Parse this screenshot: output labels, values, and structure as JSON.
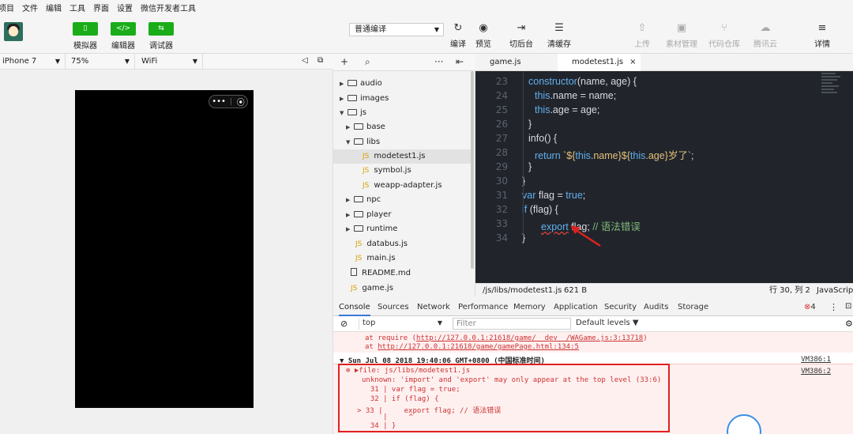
{
  "menu": [
    "项目",
    "文件",
    "编辑",
    "工具",
    "界面",
    "设置",
    "微信开发者工具"
  ],
  "toolbar": {
    "simulator": "模拟器",
    "editor": "编辑器",
    "debugger": "调试器",
    "compile_mode": "普通编译",
    "compile": "编译",
    "preview": "预览",
    "background": "切后台",
    "clear_cache": "清缓存",
    "upload": "上传",
    "assets": "素材管理",
    "repo": "代码仓库",
    "tencent_cloud": "腾讯云",
    "details": "详情",
    "accent_color": "#1aad19"
  },
  "device": {
    "model": "iPhone 7",
    "zoom": "75%",
    "network": "WiFi"
  },
  "tree": [
    {
      "label": "audio",
      "kind": "folder",
      "expanded": false
    },
    {
      "label": "images",
      "kind": "folder",
      "expanded": false
    },
    {
      "label": "js",
      "kind": "folder",
      "expanded": true
    },
    {
      "label": "base",
      "kind": "folder",
      "expanded": false
    },
    {
      "label": "libs",
      "kind": "folder",
      "expanded": true
    },
    {
      "label": "modetest1.js",
      "kind": "js",
      "selected": true
    },
    {
      "label": "symbol.js",
      "kind": "js"
    },
    {
      "label": "weapp-adapter.js",
      "kind": "js"
    },
    {
      "label": "npc",
      "kind": "folder",
      "expanded": false
    },
    {
      "label": "player",
      "kind": "folder",
      "expanded": false
    },
    {
      "label": "runtime",
      "kind": "folder",
      "expanded": false
    },
    {
      "label": "databus.js",
      "kind": "js"
    },
    {
      "label": "main.js",
      "kind": "js"
    },
    {
      "label": "README.md",
      "kind": "doc"
    },
    {
      "label": "game.js",
      "kind": "js"
    }
  ],
  "editor_tabs": [
    {
      "label": "game.js",
      "active": false
    },
    {
      "label": "modetest1.js",
      "active": true,
      "close": "×"
    }
  ],
  "code": {
    "line_numbers": [
      "23",
      "24",
      "25",
      "26",
      "27",
      "28",
      "29",
      "30",
      "31",
      "32",
      "33",
      "34"
    ],
    "line23": {
      "kw": "constructor",
      "rest": "(name, age) {"
    },
    "line24": {
      "kw": "this",
      "rest": ".name = name;"
    },
    "line25": {
      "kw": "this",
      "rest": ".age = age;"
    },
    "line26": "}",
    "line27": "info() {",
    "line28": {
      "kw": "return",
      "s1": " `${",
      "k1": "this",
      "s2": ".name}${",
      "k2": "this",
      "s3": ".age}岁了`",
      "tail": ";"
    },
    "line29": "}",
    "line30": "}",
    "line31": {
      "kw": "var",
      "mid": " flag = ",
      "k2": "true",
      "tail": ";"
    },
    "line32": {
      "kw": "if",
      "rest": " (flag) {"
    },
    "line33": {
      "err": "export",
      "mid": " flag; ",
      "comment": "// 语法错误"
    },
    "line34": "}"
  },
  "status": {
    "path": "/js/libs/modetest1.js",
    "size": "621 B",
    "cursor": "行 30, 列 2",
    "lang": "JavaScript"
  },
  "devtools": {
    "tabs": [
      "Console",
      "Sources",
      "Network",
      "Performance",
      "Memory",
      "Application",
      "Security",
      "Audits",
      "Storage"
    ],
    "error_count": "4",
    "context": "top",
    "filter_placeholder": "Filter",
    "levels": "Default levels ▼"
  },
  "console": {
    "trace1_prefix": "at require (",
    "trace1_link": "http://127.0.0.1:21618/game/__dev__/WAGame.js:3:13718",
    "trace1_suffix": ")",
    "trace2_prefix": "at ",
    "trace2_link": "http://127.0.0.1:21618/game/gamePage.html:134:5",
    "group_header": "Sun Jul 08 2018 19:40:06 GMT+0800 (中国标准时间)",
    "group_ref": "VM386:1",
    "err_file": "file: js/libs/modetest1.js",
    "err_ref": "VM386:2",
    "err_msg": "unknown: 'import' and 'export' may only appear at the top level (33:6)",
    "ctx1": "  31 | var flag = true;",
    "ctx2": "  32 | if (flag) {",
    "ctx3": "> 33 |     export flag; // 语法错误",
    "ctx4": "     |     ^",
    "ctx5": "  34 | }"
  }
}
